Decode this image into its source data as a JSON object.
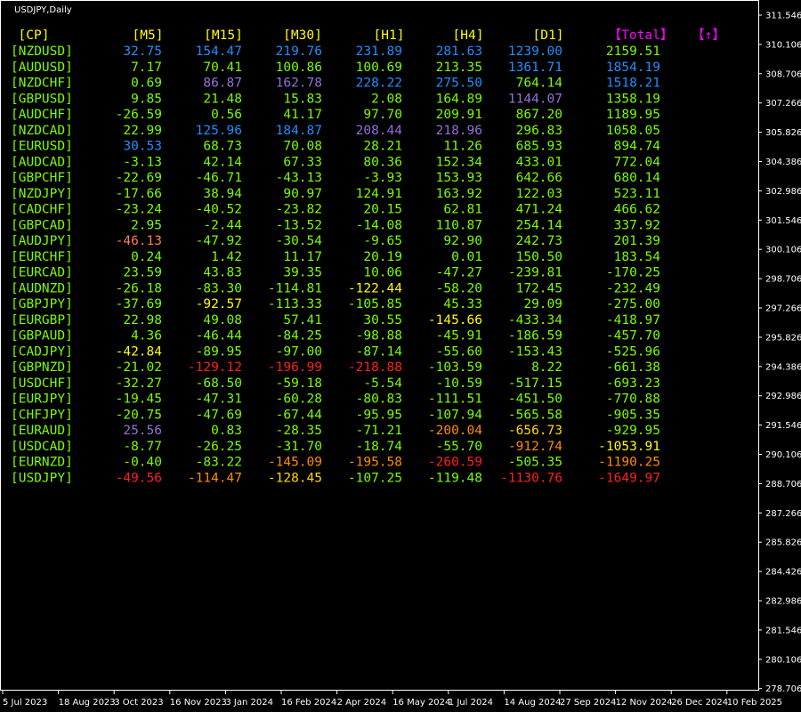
{
  "window": {
    "title": "USDJPY,Daily"
  },
  "price_axis": {
    "ticks": [
      "311.546",
      "310.106",
      "308.706",
      "307.266",
      "305.826",
      "304.386",
      "302.986",
      "301.546",
      "300.106",
      "298.706",
      "297.266",
      "295.826",
      "294.386",
      "292.986",
      "291.546",
      "290.106",
      "288.706",
      "287.266",
      "285.826",
      "284.426",
      "282.986",
      "281.546",
      "280.106",
      "278.706"
    ]
  },
  "time_axis": {
    "ticks": [
      "5 Jul 2023",
      "18 Aug 2023",
      "3 Oct 2023",
      "16 Nov 2023",
      "3 Jan 2024",
      "16 Feb 2024",
      "2 Apr 2024",
      "16 May 2024",
      "1 Jul 2024",
      "14 Aug 2024",
      "27 Sep 2024",
      "12 Nov 2024",
      "26 Dec 2024",
      "10 Feb 2025"
    ]
  },
  "strength_table": {
    "headers": [
      {
        "text": "[CP]",
        "color": "#ffff00"
      },
      {
        "text": "[M5]",
        "color": "#ffff00"
      },
      {
        "text": "[M15]",
        "color": "#ffff00"
      },
      {
        "text": "[M30]",
        "color": "#ffff00"
      },
      {
        "text": "[H1]",
        "color": "#ffff00"
      },
      {
        "text": "[H4]",
        "color": "#ffff00"
      },
      {
        "text": "[D1]",
        "color": "#ffff00"
      },
      {
        "text": "【Total】",
        "color": "#ff00ff"
      },
      {
        "text": "【↑】",
        "color": "#ff00ff"
      }
    ],
    "pair_color": "#7cfc00",
    "rows": [
      {
        "pair": "[NZDUSD]",
        "cells": [
          {
            "v": "32.75",
            "c": "#1e90ff"
          },
          {
            "v": "154.47",
            "c": "#1e90ff"
          },
          {
            "v": "219.76",
            "c": "#1e90ff"
          },
          {
            "v": "231.89",
            "c": "#1e90ff"
          },
          {
            "v": "281.63",
            "c": "#1e90ff"
          },
          {
            "v": "1239.00",
            "c": "#1e90ff"
          },
          {
            "v": "2159.51",
            "c": "#7cfc00"
          }
        ]
      },
      {
        "pair": "[AUDUSD]",
        "cells": [
          {
            "v": "7.17",
            "c": "#7cfc00"
          },
          {
            "v": "70.41",
            "c": "#7cfc00"
          },
          {
            "v": "100.86",
            "c": "#7cfc00"
          },
          {
            "v": "100.69",
            "c": "#7cfc00"
          },
          {
            "v": "213.35",
            "c": "#7cfc00"
          },
          {
            "v": "1361.71",
            "c": "#1e90ff"
          },
          {
            "v": "1854.19",
            "c": "#1e90ff"
          }
        ]
      },
      {
        "pair": "[NZDCHF]",
        "cells": [
          {
            "v": "0.69",
            "c": "#7cfc00"
          },
          {
            "v": "86.87",
            "c": "#9370db"
          },
          {
            "v": "162.78",
            "c": "#9370db"
          },
          {
            "v": "228.22",
            "c": "#1e90ff"
          },
          {
            "v": "275.50",
            "c": "#1e90ff"
          },
          {
            "v": "764.14",
            "c": "#7cfc00"
          },
          {
            "v": "1518.21",
            "c": "#1e90ff"
          }
        ]
      },
      {
        "pair": "[GBPUSD]",
        "cells": [
          {
            "v": "9.85",
            "c": "#7cfc00"
          },
          {
            "v": "21.48",
            "c": "#7cfc00"
          },
          {
            "v": "15.83",
            "c": "#7cfc00"
          },
          {
            "v": "2.08",
            "c": "#7cfc00"
          },
          {
            "v": "164.89",
            "c": "#7cfc00"
          },
          {
            "v": "1144.07",
            "c": "#9370db"
          },
          {
            "v": "1358.19",
            "c": "#7cfc00"
          }
        ]
      },
      {
        "pair": "[AUDCHF]",
        "cells": [
          {
            "v": "-26.59",
            "c": "#7cfc00"
          },
          {
            "v": "0.56",
            "c": "#7cfc00"
          },
          {
            "v": "41.17",
            "c": "#7cfc00"
          },
          {
            "v": "97.70",
            "c": "#7cfc00"
          },
          {
            "v": "209.91",
            "c": "#7cfc00"
          },
          {
            "v": "867.20",
            "c": "#7cfc00"
          },
          {
            "v": "1189.95",
            "c": "#7cfc00"
          }
        ]
      },
      {
        "pair": "[NZDCAD]",
        "cells": [
          {
            "v": "22.99",
            "c": "#7cfc00"
          },
          {
            "v": "125.96",
            "c": "#1e90ff"
          },
          {
            "v": "184.87",
            "c": "#1e90ff"
          },
          {
            "v": "208.44",
            "c": "#9370db"
          },
          {
            "v": "218.96",
            "c": "#9370db"
          },
          {
            "v": "296.83",
            "c": "#7cfc00"
          },
          {
            "v": "1058.05",
            "c": "#7cfc00"
          }
        ]
      },
      {
        "pair": "[EURUSD]",
        "cells": [
          {
            "v": "30.53",
            "c": "#1e90ff"
          },
          {
            "v": "68.73",
            "c": "#7cfc00"
          },
          {
            "v": "70.08",
            "c": "#7cfc00"
          },
          {
            "v": "28.21",
            "c": "#7cfc00"
          },
          {
            "v": "11.26",
            "c": "#7cfc00"
          },
          {
            "v": "685.93",
            "c": "#7cfc00"
          },
          {
            "v": "894.74",
            "c": "#7cfc00"
          }
        ]
      },
      {
        "pair": "[AUDCAD]",
        "cells": [
          {
            "v": "-3.13",
            "c": "#7cfc00"
          },
          {
            "v": "42.14",
            "c": "#7cfc00"
          },
          {
            "v": "67.33",
            "c": "#7cfc00"
          },
          {
            "v": "80.36",
            "c": "#7cfc00"
          },
          {
            "v": "152.34",
            "c": "#7cfc00"
          },
          {
            "v": "433.01",
            "c": "#7cfc00"
          },
          {
            "v": "772.04",
            "c": "#7cfc00"
          }
        ]
      },
      {
        "pair": "[GBPCHF]",
        "cells": [
          {
            "v": "-22.69",
            "c": "#7cfc00"
          },
          {
            "v": "-46.71",
            "c": "#7cfc00"
          },
          {
            "v": "-43.13",
            "c": "#7cfc00"
          },
          {
            "v": "-3.93",
            "c": "#7cfc00"
          },
          {
            "v": "153.93",
            "c": "#7cfc00"
          },
          {
            "v": "642.66",
            "c": "#7cfc00"
          },
          {
            "v": "680.14",
            "c": "#7cfc00"
          }
        ]
      },
      {
        "pair": "[NZDJPY]",
        "cells": [
          {
            "v": "-17.66",
            "c": "#7cfc00"
          },
          {
            "v": "38.94",
            "c": "#7cfc00"
          },
          {
            "v": "90.97",
            "c": "#7cfc00"
          },
          {
            "v": "124.91",
            "c": "#7cfc00"
          },
          {
            "v": "163.92",
            "c": "#7cfc00"
          },
          {
            "v": "122.03",
            "c": "#7cfc00"
          },
          {
            "v": "523.11",
            "c": "#7cfc00"
          }
        ]
      },
      {
        "pair": "[CADCHF]",
        "cells": [
          {
            "v": "-23.24",
            "c": "#7cfc00"
          },
          {
            "v": "-40.52",
            "c": "#7cfc00"
          },
          {
            "v": "-23.82",
            "c": "#7cfc00"
          },
          {
            "v": "20.15",
            "c": "#7cfc00"
          },
          {
            "v": "62.81",
            "c": "#7cfc00"
          },
          {
            "v": "471.24",
            "c": "#7cfc00"
          },
          {
            "v": "466.62",
            "c": "#7cfc00"
          }
        ]
      },
      {
        "pair": "[GBPCAD]",
        "cells": [
          {
            "v": "2.95",
            "c": "#7cfc00"
          },
          {
            "v": "-2.44",
            "c": "#7cfc00"
          },
          {
            "v": "-13.52",
            "c": "#7cfc00"
          },
          {
            "v": "-14.08",
            "c": "#7cfc00"
          },
          {
            "v": "110.87",
            "c": "#7cfc00"
          },
          {
            "v": "254.14",
            "c": "#7cfc00"
          },
          {
            "v": "337.92",
            "c": "#7cfc00"
          }
        ]
      },
      {
        "pair": "[AUDJPY]",
        "cells": [
          {
            "v": "-46.13",
            "c": "#ff7f50"
          },
          {
            "v": "-47.92",
            "c": "#7cfc00"
          },
          {
            "v": "-30.54",
            "c": "#7cfc00"
          },
          {
            "v": "-9.65",
            "c": "#7cfc00"
          },
          {
            "v": "92.90",
            "c": "#7cfc00"
          },
          {
            "v": "242.73",
            "c": "#7cfc00"
          },
          {
            "v": "201.39",
            "c": "#7cfc00"
          }
        ]
      },
      {
        "pair": "[EURCHF]",
        "cells": [
          {
            "v": "0.24",
            "c": "#7cfc00"
          },
          {
            "v": "1.42",
            "c": "#7cfc00"
          },
          {
            "v": "11.17",
            "c": "#7cfc00"
          },
          {
            "v": "20.19",
            "c": "#7cfc00"
          },
          {
            "v": "0.01",
            "c": "#7cfc00"
          },
          {
            "v": "150.50",
            "c": "#7cfc00"
          },
          {
            "v": "183.54",
            "c": "#7cfc00"
          }
        ]
      },
      {
        "pair": "[EURCAD]",
        "cells": [
          {
            "v": "23.59",
            "c": "#7cfc00"
          },
          {
            "v": "43.83",
            "c": "#7cfc00"
          },
          {
            "v": "39.35",
            "c": "#7cfc00"
          },
          {
            "v": "10.06",
            "c": "#7cfc00"
          },
          {
            "v": "-47.27",
            "c": "#7cfc00"
          },
          {
            "v": "-239.81",
            "c": "#7cfc00"
          },
          {
            "v": "-170.25",
            "c": "#7cfc00"
          }
        ]
      },
      {
        "pair": "[AUDNZD]",
        "cells": [
          {
            "v": "-26.18",
            "c": "#7cfc00"
          },
          {
            "v": "-83.30",
            "c": "#7cfc00"
          },
          {
            "v": "-114.81",
            "c": "#7cfc00"
          },
          {
            "v": "-122.44",
            "c": "#ffff00"
          },
          {
            "v": "-58.20",
            "c": "#7cfc00"
          },
          {
            "v": "172.45",
            "c": "#7cfc00"
          },
          {
            "v": "-232.49",
            "c": "#7cfc00"
          }
        ]
      },
      {
        "pair": "[GBPJPY]",
        "cells": [
          {
            "v": "-37.69",
            "c": "#7cfc00"
          },
          {
            "v": "-92.57",
            "c": "#ffff00"
          },
          {
            "v": "-113.33",
            "c": "#7cfc00"
          },
          {
            "v": "-105.85",
            "c": "#7cfc00"
          },
          {
            "v": "45.33",
            "c": "#7cfc00"
          },
          {
            "v": "29.09",
            "c": "#7cfc00"
          },
          {
            "v": "-275.00",
            "c": "#7cfc00"
          }
        ]
      },
      {
        "pair": "[EURGBP]",
        "cells": [
          {
            "v": "22.98",
            "c": "#7cfc00"
          },
          {
            "v": "49.08",
            "c": "#7cfc00"
          },
          {
            "v": "57.41",
            "c": "#7cfc00"
          },
          {
            "v": "30.55",
            "c": "#7cfc00"
          },
          {
            "v": "-145.66",
            "c": "#ffff00"
          },
          {
            "v": "-433.34",
            "c": "#7cfc00"
          },
          {
            "v": "-418.97",
            "c": "#7cfc00"
          }
        ]
      },
      {
        "pair": "[GBPAUD]",
        "cells": [
          {
            "v": "4.36",
            "c": "#7cfc00"
          },
          {
            "v": "-46.44",
            "c": "#7cfc00"
          },
          {
            "v": "-84.25",
            "c": "#7cfc00"
          },
          {
            "v": "-98.88",
            "c": "#7cfc00"
          },
          {
            "v": "-45.91",
            "c": "#7cfc00"
          },
          {
            "v": "-186.59",
            "c": "#7cfc00"
          },
          {
            "v": "-457.70",
            "c": "#7cfc00"
          }
        ]
      },
      {
        "pair": "[CADJPY]",
        "cells": [
          {
            "v": "-42.84",
            "c": "#ffff00"
          },
          {
            "v": "-89.95",
            "c": "#7cfc00"
          },
          {
            "v": "-97.00",
            "c": "#7cfc00"
          },
          {
            "v": "-87.14",
            "c": "#7cfc00"
          },
          {
            "v": "-55.60",
            "c": "#7cfc00"
          },
          {
            "v": "-153.43",
            "c": "#7cfc00"
          },
          {
            "v": "-525.96",
            "c": "#7cfc00"
          }
        ]
      },
      {
        "pair": "[GBPNZD]",
        "cells": [
          {
            "v": "-21.02",
            "c": "#7cfc00"
          },
          {
            "v": "-129.12",
            "c": "#ff2020"
          },
          {
            "v": "-196.99",
            "c": "#ff2020"
          },
          {
            "v": "-218.88",
            "c": "#ff2020"
          },
          {
            "v": "-103.59",
            "c": "#7cfc00"
          },
          {
            "v": "8.22",
            "c": "#7cfc00"
          },
          {
            "v": "-661.38",
            "c": "#7cfc00"
          }
        ]
      },
      {
        "pair": "[USDCHF]",
        "cells": [
          {
            "v": "-32.27",
            "c": "#7cfc00"
          },
          {
            "v": "-68.50",
            "c": "#7cfc00"
          },
          {
            "v": "-59.18",
            "c": "#7cfc00"
          },
          {
            "v": "-5.54",
            "c": "#7cfc00"
          },
          {
            "v": "-10.59",
            "c": "#7cfc00"
          },
          {
            "v": "-517.15",
            "c": "#7cfc00"
          },
          {
            "v": "-693.23",
            "c": "#7cfc00"
          }
        ]
      },
      {
        "pair": "[EURJPY]",
        "cells": [
          {
            "v": "-19.45",
            "c": "#7cfc00"
          },
          {
            "v": "-47.31",
            "c": "#7cfc00"
          },
          {
            "v": "-60.28",
            "c": "#7cfc00"
          },
          {
            "v": "-80.83",
            "c": "#7cfc00"
          },
          {
            "v": "-111.51",
            "c": "#7cfc00"
          },
          {
            "v": "-451.50",
            "c": "#7cfc00"
          },
          {
            "v": "-770.88",
            "c": "#7cfc00"
          }
        ]
      },
      {
        "pair": "[CHFJPY]",
        "cells": [
          {
            "v": "-20.75",
            "c": "#7cfc00"
          },
          {
            "v": "-47.69",
            "c": "#7cfc00"
          },
          {
            "v": "-67.44",
            "c": "#7cfc00"
          },
          {
            "v": "-95.95",
            "c": "#7cfc00"
          },
          {
            "v": "-107.94",
            "c": "#7cfc00"
          },
          {
            "v": "-565.58",
            "c": "#7cfc00"
          },
          {
            "v": "-905.35",
            "c": "#7cfc00"
          }
        ]
      },
      {
        "pair": "[EURAUD]",
        "cells": [
          {
            "v": "25.56",
            "c": "#9370db"
          },
          {
            "v": "0.83",
            "c": "#7cfc00"
          },
          {
            "v": "-28.35",
            "c": "#7cfc00"
          },
          {
            "v": "-71.21",
            "c": "#7cfc00"
          },
          {
            "v": "-200.04",
            "c": "#ff8c00"
          },
          {
            "v": "-656.73",
            "c": "#ffd700"
          },
          {
            "v": "-929.95",
            "c": "#7cfc00"
          }
        ]
      },
      {
        "pair": "[USDCAD]",
        "cells": [
          {
            "v": "-8.77",
            "c": "#7cfc00"
          },
          {
            "v": "-26.25",
            "c": "#7cfc00"
          },
          {
            "v": "-31.70",
            "c": "#7cfc00"
          },
          {
            "v": "-18.74",
            "c": "#7cfc00"
          },
          {
            "v": "-55.70",
            "c": "#7cfc00"
          },
          {
            "v": "-912.74",
            "c": "#ff8c00"
          },
          {
            "v": "-1053.91",
            "c": "#ffff00"
          }
        ]
      },
      {
        "pair": "[EURNZD]",
        "cells": [
          {
            "v": "-0.40",
            "c": "#7cfc00"
          },
          {
            "v": "-83.22",
            "c": "#7cfc00"
          },
          {
            "v": "-145.09",
            "c": "#ff8c00"
          },
          {
            "v": "-195.58",
            "c": "#ff8c00"
          },
          {
            "v": "-260.59",
            "c": "#ff2020"
          },
          {
            "v": "-505.35",
            "c": "#7cfc00"
          },
          {
            "v": "-1190.25",
            "c": "#ff8c00"
          }
        ]
      },
      {
        "pair": "[USDJPY]",
        "cells": [
          {
            "v": "-49.56",
            "c": "#ff2020"
          },
          {
            "v": "-114.47",
            "c": "#ff8c00"
          },
          {
            "v": "-128.45",
            "c": "#ffd700"
          },
          {
            "v": "-107.25",
            "c": "#7cfc00"
          },
          {
            "v": "-119.48",
            "c": "#7cfc00"
          },
          {
            "v": "-1130.76",
            "c": "#ff2020"
          },
          {
            "v": "-1649.97",
            "c": "#ff2020"
          }
        ]
      }
    ]
  }
}
